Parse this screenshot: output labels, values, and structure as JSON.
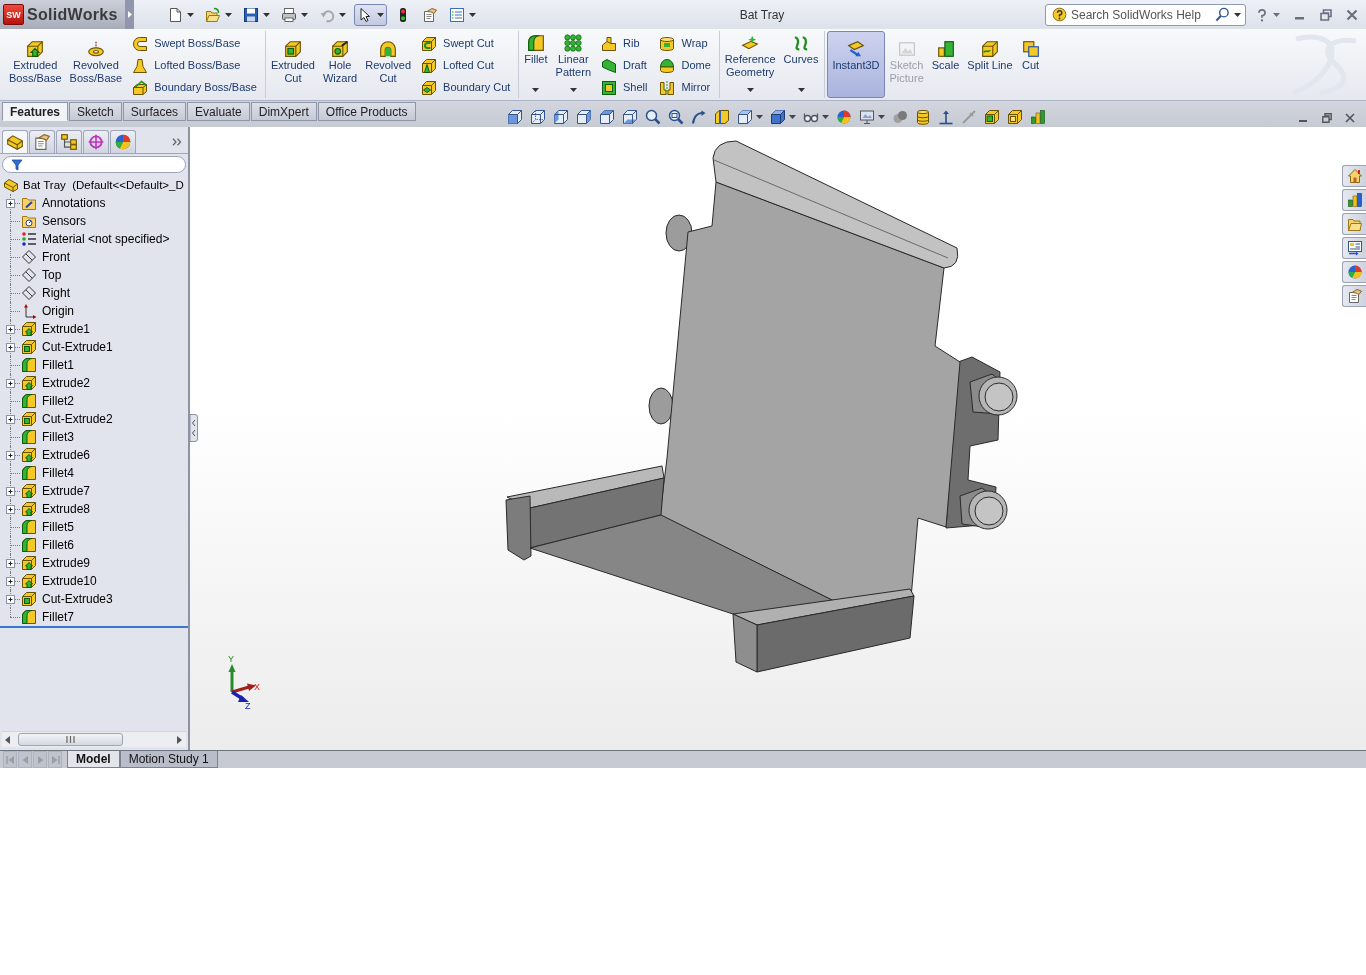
{
  "title_bar": {
    "logo_mark": "SW",
    "app_name": "SolidWorks",
    "title": "Bat Tray",
    "search": {
      "placeholder": "Search SolidWorks Help"
    }
  },
  "quick_access": [
    {
      "pressed": false,
      "disabled": false,
      "dropdown": true
    },
    {
      "pressed": false,
      "disabled": false,
      "dropdown": true
    },
    {
      "pressed": false,
      "disabled": false,
      "dropdown": true
    },
    {
      "pressed": false,
      "disabled": false,
      "dropdown": true
    },
    {
      "pressed": false,
      "disabled": true,
      "dropdown": true
    },
    {
      "pressed": true,
      "disabled": false,
      "dropdown": true
    },
    {
      "pressed": false,
      "disabled": false,
      "dropdown": false
    },
    {
      "pressed": false,
      "disabled": false,
      "dropdown": false
    },
    {
      "pressed": false,
      "disabled": false,
      "dropdown": true
    }
  ],
  "command_manager": {
    "groups": [
      {
        "columns": [
          {
            "kind": "large",
            "buttons": [
              {
                "label": "Extruded\nBoss/Base",
                "on": false,
                "disabled": false,
                "dropdown": false
              }
            ]
          },
          {
            "kind": "large",
            "buttons": [
              {
                "label": "Revolved\nBoss/Base",
                "on": false,
                "disabled": false,
                "dropdown": false
              }
            ]
          },
          {
            "kind": "stack",
            "buttons": [
              {
                "label": "Swept Boss/Base",
                "on": false,
                "disabled": false,
                "dropdown": false
              },
              {
                "label": "Lofted Boss/Base",
                "on": false,
                "disabled": false,
                "dropdown": false
              },
              {
                "label": "Boundary Boss/Base",
                "on": false,
                "disabled": false,
                "dropdown": false
              }
            ]
          }
        ]
      },
      {
        "columns": [
          {
            "kind": "large",
            "buttons": [
              {
                "label": "Extruded\nCut",
                "on": false,
                "disabled": false,
                "dropdown": false
              }
            ]
          },
          {
            "kind": "large",
            "buttons": [
              {
                "label": "Hole\nWizard",
                "on": false,
                "disabled": false,
                "dropdown": false
              }
            ]
          },
          {
            "kind": "large",
            "buttons": [
              {
                "label": "Revolved\nCut",
                "on": false,
                "disabled": false,
                "dropdown": false
              }
            ]
          },
          {
            "kind": "stack",
            "buttons": [
              {
                "label": "Swept Cut",
                "on": false,
                "disabled": false,
                "dropdown": false
              },
              {
                "label": "Lofted Cut",
                "on": false,
                "disabled": false,
                "dropdown": false
              },
              {
                "label": "Boundary Cut",
                "on": false,
                "disabled": false,
                "dropdown": false
              }
            ]
          }
        ]
      },
      {
        "columns": [
          {
            "kind": "large",
            "buttons": [
              {
                "label": "Fillet",
                "on": false,
                "disabled": false,
                "dropdown": true
              }
            ]
          },
          {
            "kind": "large",
            "buttons": [
              {
                "label": "Linear\nPattern",
                "on": false,
                "disabled": false,
                "dropdown": true
              }
            ]
          },
          {
            "kind": "stack",
            "buttons": [
              {
                "label": "Rib",
                "on": false,
                "disabled": false,
                "dropdown": false
              },
              {
                "label": "Draft",
                "on": false,
                "disabled": false,
                "dropdown": false
              },
              {
                "label": "Shell",
                "on": false,
                "disabled": false,
                "dropdown": false
              }
            ]
          },
          {
            "kind": "stack",
            "buttons": [
              {
                "label": "Wrap",
                "on": false,
                "disabled": false,
                "dropdown": false
              },
              {
                "label": "Dome",
                "on": false,
                "disabled": false,
                "dropdown": false
              },
              {
                "label": "Mirror",
                "on": false,
                "disabled": false,
                "dropdown": false
              }
            ]
          }
        ]
      },
      {
        "columns": [
          {
            "kind": "large",
            "buttons": [
              {
                "label": "Reference\nGeometry",
                "on": false,
                "disabled": false,
                "dropdown": true
              }
            ]
          },
          {
            "kind": "large",
            "buttons": [
              {
                "label": "Curves",
                "on": false,
                "disabled": false,
                "dropdown": true
              }
            ]
          }
        ]
      },
      {
        "columns": [
          {
            "kind": "large",
            "buttons": [
              {
                "label": "Instant3D",
                "on": true,
                "disabled": false,
                "dropdown": false
              }
            ]
          },
          {
            "kind": "large",
            "buttons": [
              {
                "label": "Sketch\nPicture",
                "on": false,
                "disabled": true,
                "dropdown": false
              }
            ]
          },
          {
            "kind": "large",
            "buttons": [
              {
                "label": "Scale",
                "on": false,
                "disabled": false,
                "dropdown": false
              }
            ]
          },
          {
            "kind": "large",
            "buttons": [
              {
                "label": "Split Line",
                "on": false,
                "disabled": false,
                "dropdown": false
              }
            ]
          },
          {
            "kind": "large",
            "buttons": [
              {
                "label": "Cut",
                "on": false,
                "disabled": false,
                "dropdown": false
              }
            ]
          }
        ]
      }
    ],
    "tabs": [
      {
        "label": "Features",
        "selected": true
      },
      {
        "label": "Sketch",
        "selected": false
      },
      {
        "label": "Surfaces",
        "selected": false
      },
      {
        "label": "Evaluate",
        "selected": false
      },
      {
        "label": "DimXpert",
        "selected": false
      },
      {
        "label": "Office Products",
        "selected": false
      }
    ]
  },
  "feature_manager": {
    "tabs": [
      {
        "selected": true
      },
      {
        "selected": false
      },
      {
        "selected": false
      },
      {
        "selected": false
      },
      {
        "selected": false
      }
    ],
    "tree": {
      "label": "Bat Tray  (Default<<Default>_D",
      "kind": "part",
      "children": [
        {
          "label": "Annotations",
          "kind": "annotations",
          "expandable": true,
          "expanded": false
        },
        {
          "label": "Sensors",
          "kind": "sensors",
          "expandable": false,
          "expanded": false
        },
        {
          "label": "Material <not specified>",
          "kind": "material",
          "expandable": false,
          "expanded": false
        },
        {
          "label": "Front",
          "kind": "plane",
          "expandable": false,
          "expanded": false
        },
        {
          "label": "Top",
          "kind": "plane",
          "expandable": false,
          "expanded": false
        },
        {
          "label": "Right",
          "kind": "plane",
          "expandable": false,
          "expanded": false
        },
        {
          "label": "Origin",
          "kind": "origin",
          "expandable": false,
          "expanded": false
        },
        {
          "label": "Extrude1",
          "kind": "extrude",
          "expandable": true,
          "expanded": false
        },
        {
          "label": "Cut-Extrude1",
          "kind": "cut",
          "expandable": true,
          "expanded": false
        },
        {
          "label": "Fillet1",
          "kind": "fillet",
          "expandable": false,
          "expanded": false
        },
        {
          "label": "Extrude2",
          "kind": "extrude",
          "expandable": true,
          "expanded": false
        },
        {
          "label": "Fillet2",
          "kind": "fillet",
          "expandable": false,
          "expanded": false
        },
        {
          "label": "Cut-Extrude2",
          "kind": "cut",
          "expandable": true,
          "expanded": false
        },
        {
          "label": "Fillet3",
          "kind": "fillet",
          "expandable": false,
          "expanded": false
        },
        {
          "label": "Extrude6",
          "kind": "extrude",
          "expandable": true,
          "expanded": false
        },
        {
          "label": "Fillet4",
          "kind": "fillet",
          "expandable": false,
          "expanded": false
        },
        {
          "label": "Extrude7",
          "kind": "extrude",
          "expandable": true,
          "expanded": false
        },
        {
          "label": "Extrude8",
          "kind": "extrude",
          "expandable": true,
          "expanded": false
        },
        {
          "label": "Fillet5",
          "kind": "fillet",
          "expandable": false,
          "expanded": false
        },
        {
          "label": "Fillet6",
          "kind": "fillet",
          "expandable": false,
          "expanded": false
        },
        {
          "label": "Extrude9",
          "kind": "extrude",
          "expandable": true,
          "expanded": false
        },
        {
          "label": "Extrude10",
          "kind": "extrude",
          "expandable": true,
          "expanded": false
        },
        {
          "label": "Cut-Extrude3",
          "kind": "cut",
          "expandable": true,
          "expanded": false
        },
        {
          "label": "Fillet7",
          "kind": "fillet",
          "expandable": false,
          "expanded": false
        }
      ]
    }
  },
  "graphics_area": {
    "triad": {
      "x": "X",
      "y": "Y",
      "z": "Z"
    }
  },
  "bottom_bar": {
    "nav_disabled": true,
    "tabs": [
      {
        "label": "Model",
        "selected": true
      },
      {
        "label": "Motion Study 1",
        "selected": false
      }
    ]
  }
}
